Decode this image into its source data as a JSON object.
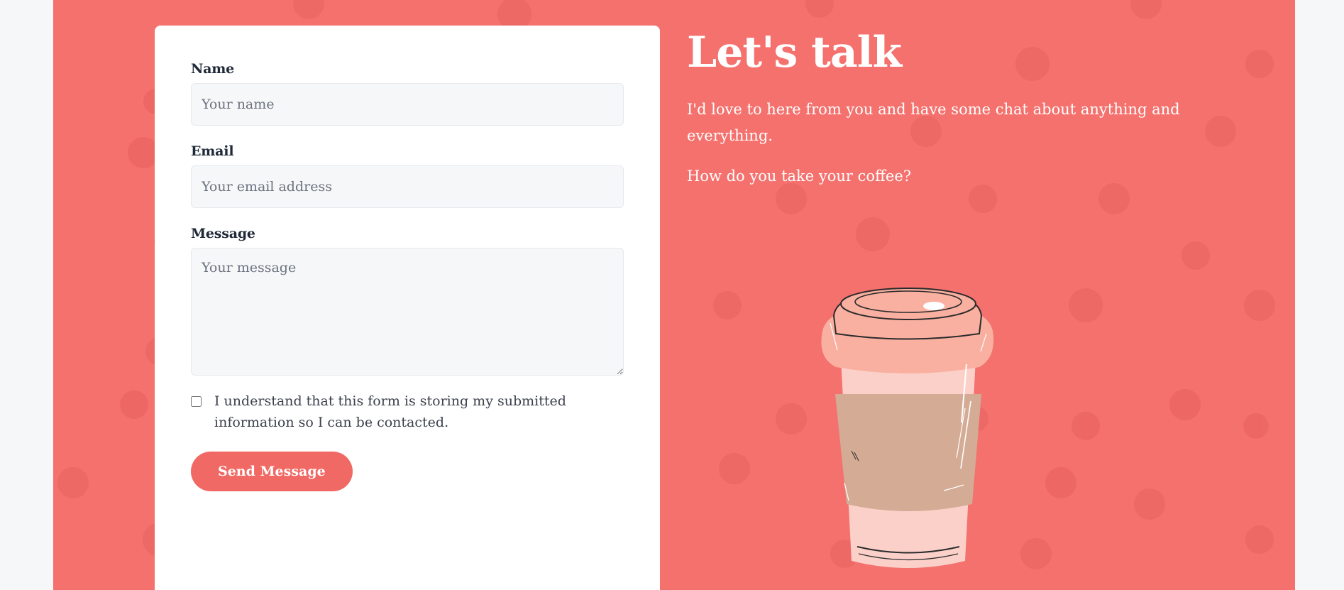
{
  "contact": {
    "name_label": "Name",
    "name_placeholder": "Your name",
    "email_label": "Email",
    "email_placeholder": "Your email address",
    "message_label": "Message",
    "message_placeholder": "Your message",
    "consent_text": "I understand that this form is storing my submitted information so I can be contacted.",
    "consent_checked": false,
    "send_label": "Send Message"
  },
  "intro": {
    "heading": "Let's talk",
    "paragraph_1": "I'd love to here from you and have some chat about anything and everything.",
    "paragraph_2": "How do you take your coffee?"
  },
  "illustration": {
    "name": "coffee-cup-illustration"
  },
  "colors": {
    "background": "#f4716d",
    "page": "#f6f7f9",
    "card": "#ffffff",
    "button": "#f16964",
    "cup_lid": "#f9b0a1",
    "cup_sleeve": "#d4ab94",
    "cup_body": "#fbd0c9"
  }
}
